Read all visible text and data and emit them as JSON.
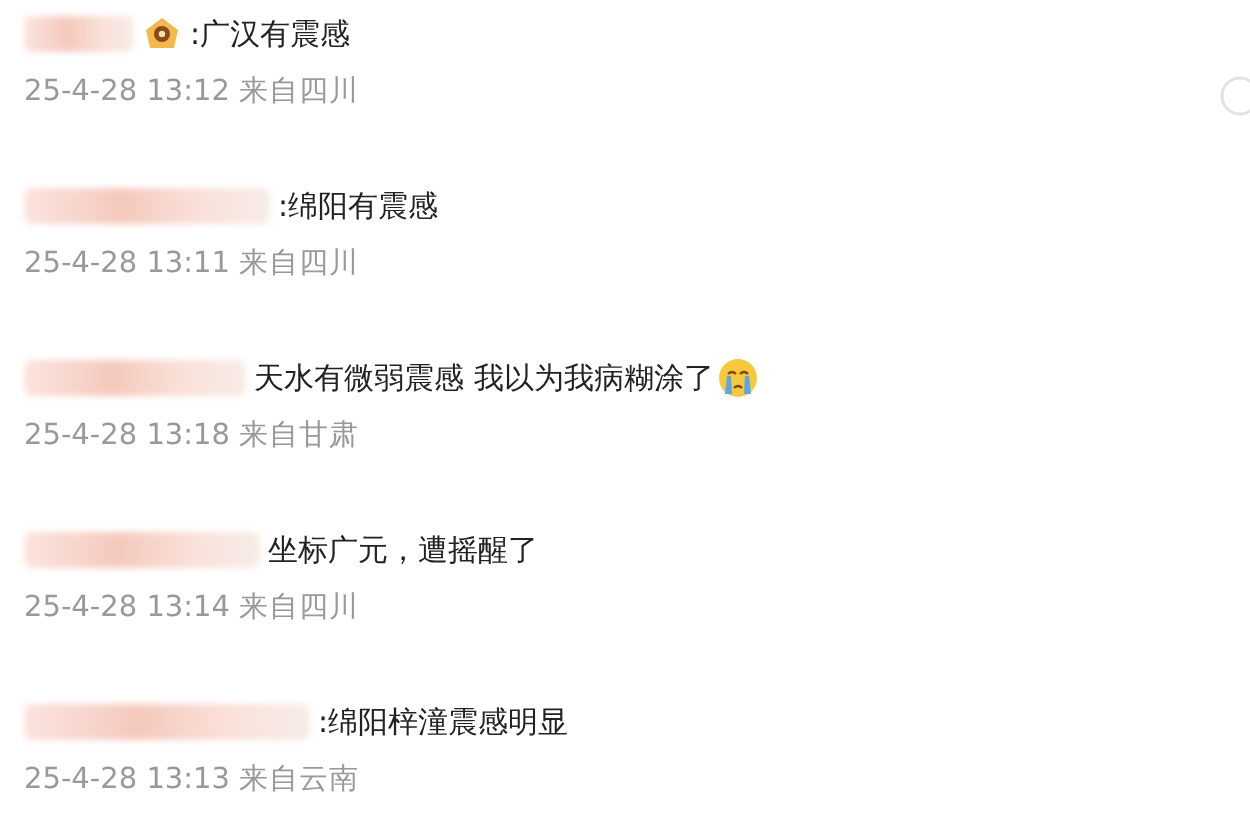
{
  "comments": [
    {
      "user_badge": true,
      "text": ":广汉有震感",
      "trailing_emoji": false,
      "time": "25-4-28 13:12",
      "location": "来自四川"
    },
    {
      "user_badge": false,
      "text": ":绵阳有震感",
      "trailing_emoji": false,
      "time": "25-4-28 13:11",
      "location": "来自四川"
    },
    {
      "user_badge": false,
      "text": "天水有微弱震感 我以为我病糊涂了",
      "trailing_emoji": true,
      "time": "25-4-28 13:18",
      "location": "来自甘肃"
    },
    {
      "user_badge": false,
      "text": "坐标广元，遭摇醒了",
      "trailing_emoji": false,
      "time": "25-4-28 13:14",
      "location": "来自四川"
    },
    {
      "user_badge": false,
      "text": ":绵阳梓潼震感明显",
      "trailing_emoji": false,
      "time": "25-4-28 13:13",
      "location": "来自云南"
    }
  ]
}
